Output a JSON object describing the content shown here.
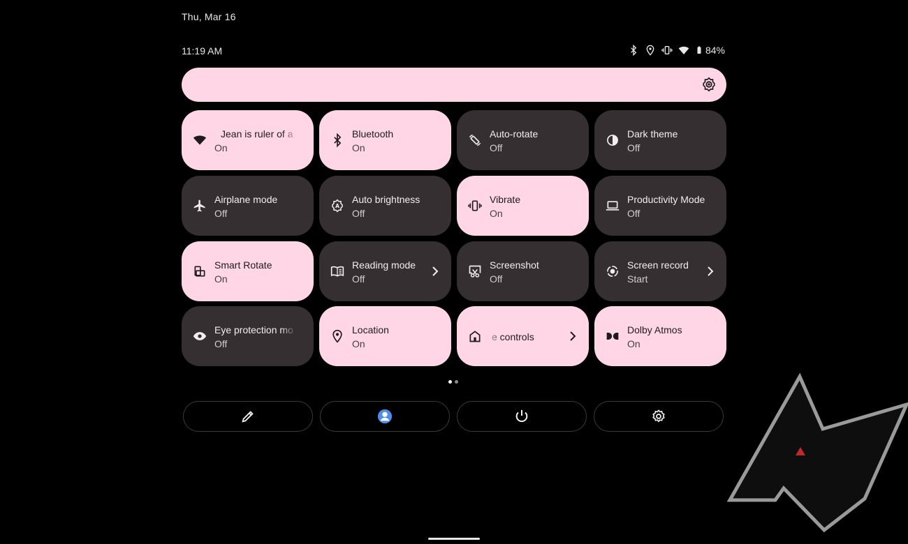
{
  "header": {
    "date": "Thu, Mar 16",
    "time": "11:19 AM",
    "battery": "84%",
    "status_icons": [
      "bluetooth-icon",
      "location-icon",
      "vibrate-icon",
      "wifi-icon",
      "battery-icon"
    ]
  },
  "colors": {
    "background": "#000000",
    "tile_on": "#ffd6e6",
    "tile_off": "#352f32",
    "on_text": "#1f1a1d",
    "off_text": "#f2eef0"
  },
  "tiles": [
    {
      "label": "Jean is ruler of a",
      "sub": "On",
      "state": "on",
      "icon": "wifi-icon"
    },
    {
      "label": "Bluetooth",
      "sub": "On",
      "state": "on",
      "icon": "bluetooth-icon"
    },
    {
      "label": "Auto-rotate",
      "sub": "Off",
      "state": "off",
      "icon": "auto-rotate-icon"
    },
    {
      "label": "Dark theme",
      "sub": "Off",
      "state": "off",
      "icon": "dark-theme-icon"
    },
    {
      "label": "Airplane mode",
      "sub": "Off",
      "state": "off",
      "icon": "airplane-icon"
    },
    {
      "label": "Auto brightness",
      "sub": "Off",
      "state": "off",
      "icon": "auto-brightness-icon"
    },
    {
      "label": "Vibrate",
      "sub": "On",
      "state": "on",
      "icon": "vibrate-icon"
    },
    {
      "label": "Productivity Mode",
      "sub": "Off",
      "state": "off",
      "icon": "laptop-icon"
    },
    {
      "label": "Smart Rotate",
      "sub": "On",
      "state": "on",
      "icon": "smart-rotate-icon"
    },
    {
      "label": "Reading mode",
      "sub": "Off",
      "state": "off",
      "icon": "book-icon"
    },
    {
      "label": "Screenshot",
      "sub": "Off",
      "state": "off",
      "icon": "screenshot-icon"
    },
    {
      "label": "Screen record",
      "sub": "Start",
      "state": "off",
      "icon": "screen-record-icon"
    },
    {
      "label": "Eye protection mo",
      "sub": "Off",
      "state": "off",
      "icon": "eye-icon"
    },
    {
      "label": "Location",
      "sub": "On",
      "state": "on",
      "icon": "location-icon"
    },
    {
      "label": "e controls",
      "sub": "",
      "state": "on",
      "icon": "home-icon"
    },
    {
      "label": "Dolby Atmos",
      "sub": "On",
      "state": "on",
      "icon": "dolby-icon"
    }
  ],
  "pager": {
    "pages": 2,
    "current": 1
  },
  "actions": [
    "edit-icon",
    "user-icon",
    "power-icon",
    "settings-icon"
  ]
}
